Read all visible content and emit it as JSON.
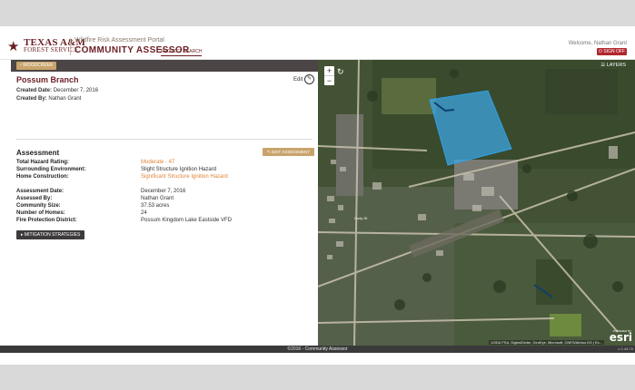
{
  "header": {
    "logo_line1": "TEXAS A&M",
    "logo_line2": "FOREST SERVICE",
    "portal_name": "Wildfire Risk Assessment Portal",
    "app_title": "COMMUNITY ASSESSOR",
    "project_search": "PROJECT SEARCH",
    "welcome": "Welcome, Nathan Grant",
    "sign_off": "SIGN OFF",
    "brand_color": "#6a1e23"
  },
  "breadcrumb": {
    "back_label": "WOODCREEK"
  },
  "site": {
    "name": "Possum Branch",
    "edit_label": "Edit",
    "created_date_label": "Created Date:",
    "created_date": "December 7, 2016",
    "created_by_label": "Created By:",
    "created_by": "Nathan Grant"
  },
  "assessment": {
    "heading": "Assessment",
    "edit_button": "EDIT ASSESSMENT",
    "rows": [
      {
        "label": "Total Hazard Rating:",
        "value": "Moderate - 47"
      },
      {
        "label": "Surrounding Environment:",
        "value": "Slight Structure Ignition Hazard"
      },
      {
        "label": "Home Construction:",
        "value": "Significant Structure Ignition Hazard"
      },
      {
        "label": "Assessment Date:",
        "value": "December 7, 2016"
      },
      {
        "label": "Assessed By:",
        "value": "Nathan Grant"
      },
      {
        "label": "Community Size:",
        "value": "37.53 acres"
      },
      {
        "label": "Number of Homes:",
        "value": "24"
      },
      {
        "label": "Fire Protection District:",
        "value": "Possum Kingdom Lake Eastside VFD"
      }
    ],
    "mitigation_button": "MITIGATION STRATEGIES"
  },
  "map": {
    "layers_label": "LAYERS",
    "attribution": "USDA FSA, DigitalGlobe, GeoEye, Microsoft, CNES/Airbus DS | Es...",
    "powered_by": "POWERED BY",
    "esri": "esri",
    "road_label": "Cody St",
    "zoom_in": "+",
    "zoom_out": "−"
  },
  "footer": {
    "copyright": "©2016 - Community Assessor",
    "version": "v 1.44.70"
  }
}
